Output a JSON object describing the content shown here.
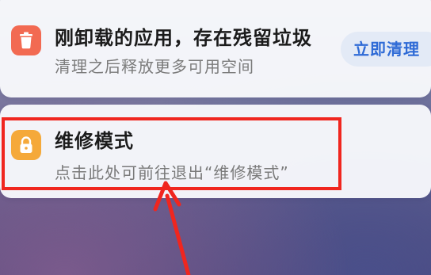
{
  "notifications": [
    {
      "icon": "trash-icon",
      "icon_color": "#f26a52",
      "title": "刚卸载的应用，存在残留垃圾",
      "subtitle": "清理之后释放更多可用空间",
      "action_label": "立即清理"
    },
    {
      "icon": "lock-icon",
      "icon_color": "#f5a93a",
      "title": "维修模式",
      "subtitle": "点击此处可前往退出“维修模式”"
    }
  ],
  "annotation": {
    "highlight_color": "#f0261f"
  }
}
